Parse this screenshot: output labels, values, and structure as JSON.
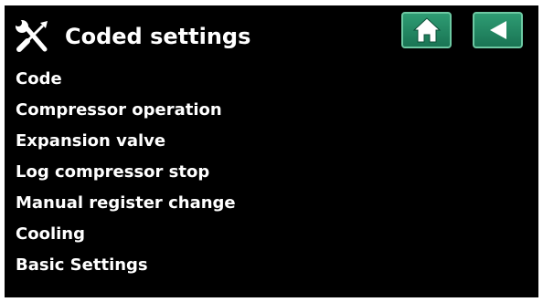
{
  "header": {
    "title": "Coded settings",
    "title_icon": "tools-icon",
    "home_icon": "home-icon",
    "back_icon": "back-arrow-icon"
  },
  "menu": {
    "items": [
      {
        "label": "Code"
      },
      {
        "label": "Compressor operation"
      },
      {
        "label": "Expansion valve"
      },
      {
        "label": "Log compressor stop"
      },
      {
        "label": "Manual register change"
      },
      {
        "label": "Cooling"
      },
      {
        "label": "Basic Settings"
      }
    ]
  },
  "colors": {
    "background": "#000000",
    "text": "#ffffff",
    "button_green": "#1f8a62",
    "button_border": "#6cc8a2"
  }
}
